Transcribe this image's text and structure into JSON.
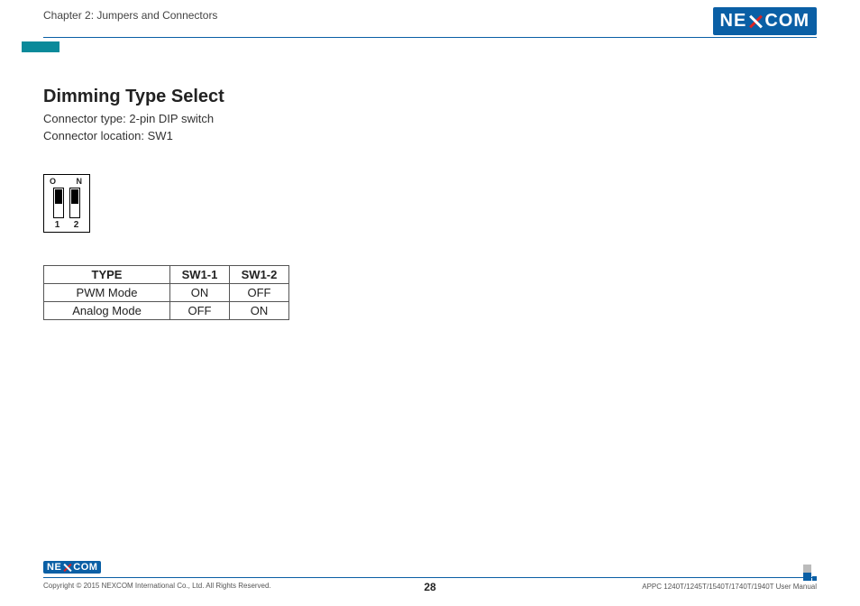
{
  "header": {
    "chapter": "Chapter 2: Jumpers and Connectors",
    "logo_left": "NE",
    "logo_right": "COM"
  },
  "section": {
    "title": "Dimming Type Select",
    "connector_type": "Connector type: 2-pin DIP switch",
    "connector_location": "Connector location: SW1"
  },
  "dip": {
    "on_label_1": "O",
    "on_label_2": "N",
    "pin1": "1",
    "pin2": "2"
  },
  "table": {
    "headers": [
      "TYPE",
      "SW1-1",
      "SW1-2"
    ],
    "rows": [
      [
        "PWM Mode",
        "ON",
        "OFF"
      ],
      [
        "Analog Mode",
        "OFF",
        "ON"
      ]
    ]
  },
  "footer": {
    "copyright": "Copyright © 2015 NEXCOM International Co., Ltd. All Rights Reserved.",
    "page": "28",
    "docname": "APPC 1240T/1245T/1540T/1740T/1940T User Manual"
  }
}
